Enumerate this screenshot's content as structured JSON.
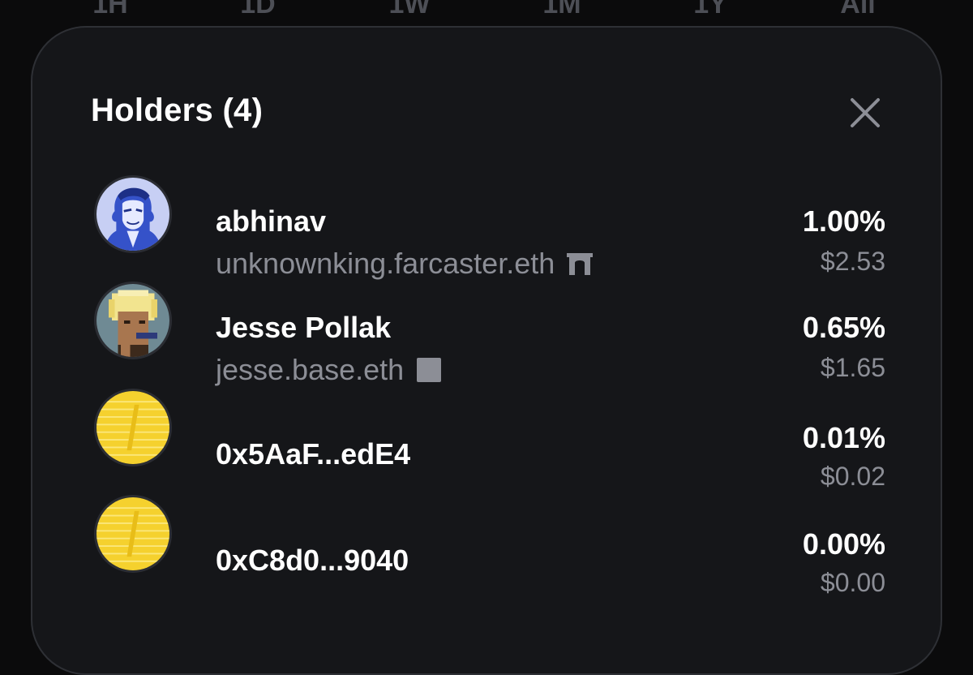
{
  "background_tabs": [
    "1H",
    "1D",
    "1W",
    "1M",
    "1Y",
    "All"
  ],
  "modal": {
    "title": "Holders (4)",
    "close_icon": "close-icon"
  },
  "holders": [
    {
      "name": "abhinav",
      "subtitle": "unknownking.farcaster.eth",
      "subtitle_icon": "farcaster-arch-icon",
      "avatar": "illustrated-portrait-avatar",
      "percent": "1.00%",
      "usd": "$2.53"
    },
    {
      "name": "Jesse Pollak",
      "subtitle": "jesse.base.eth",
      "subtitle_icon": "base-square-icon",
      "avatar": "pixel-punk-avatar",
      "percent": "0.65%",
      "usd": "$1.65"
    },
    {
      "name": "0x5AaF...edE4",
      "avatar": "gold-coin-avatar",
      "percent": "0.01%",
      "usd": "$0.02"
    },
    {
      "name": "0xC8d0...9040",
      "avatar": "gold-coin-avatar",
      "percent": "0.00%",
      "usd": "$0.00"
    }
  ],
  "colors": {
    "sheet_background": "#151619",
    "sheet_border": "#2e3035",
    "primary_text": "#ffffff",
    "secondary_text": "#8c8e96",
    "coin_gold": "#f5d12e"
  }
}
